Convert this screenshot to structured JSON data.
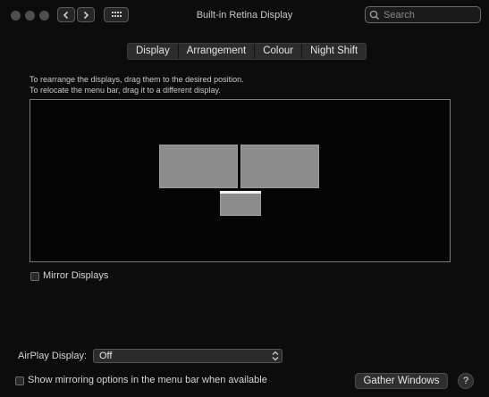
{
  "window": {
    "title": "Built-in Retina Display"
  },
  "search": {
    "placeholder": "Search"
  },
  "tabs": [
    {
      "label": "Display"
    },
    {
      "label": "Arrangement"
    },
    {
      "label": "Colour"
    },
    {
      "label": "Night Shift"
    }
  ],
  "arrangement": {
    "instruction_1": "To rearrange the displays, drag them to the desired position.",
    "instruction_2": "To relocate the menu bar, drag it to a different display."
  },
  "mirror": {
    "label": "Mirror Displays",
    "checked": false
  },
  "airplay": {
    "label": "AirPlay Display:",
    "value": "Off"
  },
  "show_mirroring": {
    "label": "Show mirroring options in the menu bar when available",
    "checked": false
  },
  "buttons": {
    "gather": "Gather Windows",
    "help": "?"
  },
  "icons": {
    "back": "chevron-left-icon",
    "forward": "chevron-right-icon",
    "grid": "grid-icon",
    "search": "search-icon",
    "select_arrows": "up-down-chevron-icon"
  }
}
